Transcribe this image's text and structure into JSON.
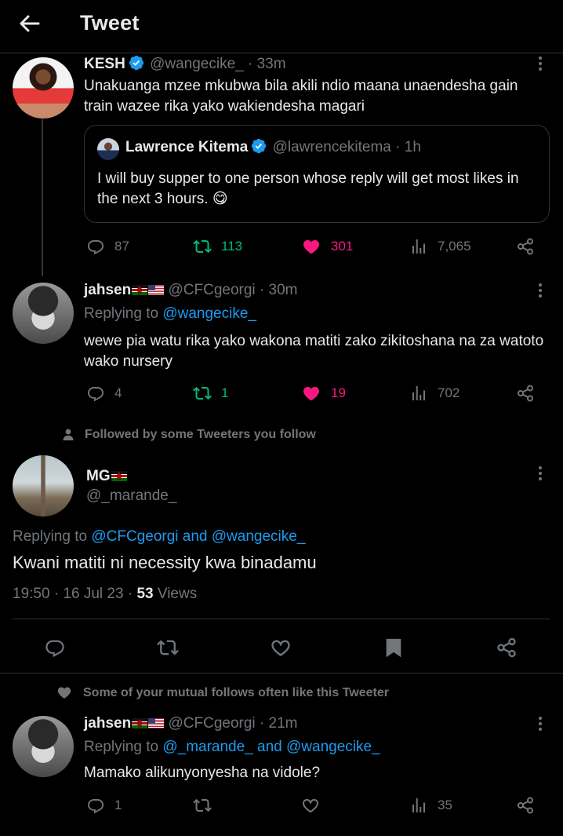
{
  "header": {
    "title": "Tweet"
  },
  "tweet1": {
    "name": "KESH",
    "handle": "@wangecike_",
    "time": "· 33m",
    "text": "Unakuanga mzee mkubwa bila akili ndio maana unaendesha gain train wazee rika yako wakiendesha magari",
    "quote": {
      "name": "Lawrence Kitema",
      "handle": "@lawrencekitema",
      "time": "· 1h",
      "text": "I will buy supper to one person whose reply will get most likes in the next 3 hours. 😋"
    },
    "replies": "87",
    "retweets": "113",
    "likes": "301",
    "views": "7,065"
  },
  "tweet2": {
    "name": "jahsen",
    "handle": "@CFCgeorgi",
    "time": "· 30m",
    "replying_prefix": "Replying to",
    "replying_to": "@wangecike_",
    "text": "wewe pia watu rika yako wakona matiti zako zikitoshana na za watoto wako nursery",
    "replies": "4",
    "retweets": "1",
    "likes": "19",
    "views": "702"
  },
  "social_context_1": "Followed by some Tweeters you follow",
  "main": {
    "name": "MG",
    "handle": "@_marande_",
    "replying_prefix": "Replying to",
    "replying_to": "@CFCgeorgi and @wangecike_",
    "text": "Kwani matiti ni necessity kwa binadamu",
    "time": "19:50 · 16 Jul 23 ·",
    "views_count": "53",
    "views_label": "Views"
  },
  "social_context_2": "Some of your mutual follows often like this Tweeter",
  "tweet3": {
    "name": "jahsen",
    "handle": "@CFCgeorgi",
    "time": "· 21m",
    "replying_prefix": "Replying to",
    "replying_to": "@_marande_ and @wangecike_",
    "text": "Mamako alikunyonyesha na vidole?",
    "replies": "1",
    "views": "35"
  },
  "colors": {
    "accent": "#1d9bf0",
    "like": "#f91880",
    "retweet": "#00ba7c",
    "muted": "#71767b",
    "border": "#2f3336"
  },
  "icons": [
    "back-arrow-icon",
    "verified-icon",
    "more-icon",
    "reply-icon",
    "retweet-icon",
    "like-icon",
    "views-icon",
    "share-icon",
    "bookmark-icon",
    "person-icon",
    "heart-icon",
    "kenya-flag-icon",
    "us-flag-icon"
  ]
}
